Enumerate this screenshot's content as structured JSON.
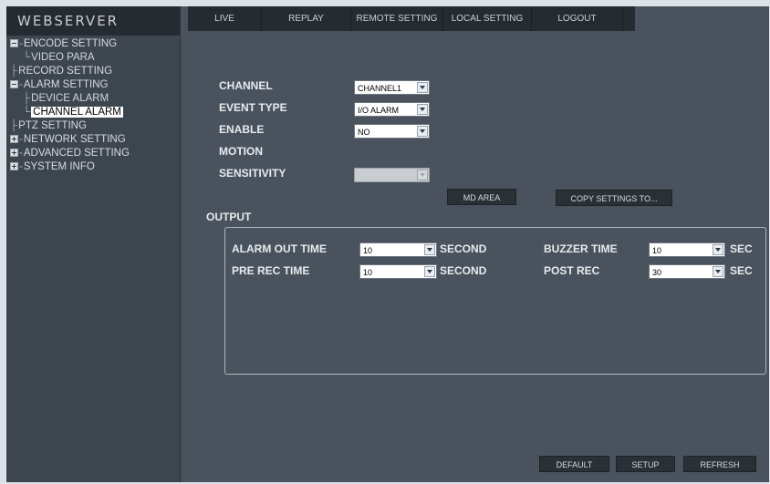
{
  "app": {
    "logo": "WEBSERVER"
  },
  "nav": [
    {
      "label": "LIVE"
    },
    {
      "label": "REPLAY"
    },
    {
      "label": "REMOTE SETTING"
    },
    {
      "label": "LOCAL SETTING"
    },
    {
      "label": "LOGOUT"
    }
  ],
  "tree": {
    "encode": "ENCODE SETTING",
    "video_para": "VIDEO PARA",
    "record": "RECORD SETTING",
    "alarm": "ALARM SETTING",
    "device_alarm": "DEVICE ALARM",
    "channel_alarm": "CHANNEL ALARM",
    "ptz": "PTZ SETTING",
    "network": "NETWORK SETTING",
    "advanced": "ADVANCED SETTING",
    "system_info": "SYSTEM INFO"
  },
  "form": {
    "channel_label": "CHANNEL",
    "channel_value": "CHANNEL1",
    "event_type_label": "EVENT TYPE",
    "event_type_value": "I/O ALARM",
    "enable_label": "ENABLE",
    "enable_value": "NO",
    "motion_label": "MOTION",
    "sensitivity_label": "SENSITIVITY",
    "sensitivity_value": "",
    "md_area_button": "MD AREA",
    "copy_settings_button": "COPY SETTINGS TO...",
    "output_label": "OUTPUT"
  },
  "output": {
    "alarm_out_time_label": "ALARM OUT TIME",
    "alarm_out_time_value": "10",
    "alarm_out_unit": "SECOND",
    "pre_rec_time_label": "PRE REC TIME",
    "pre_rec_time_value": "10",
    "pre_rec_unit": "SECOND",
    "buzzer_time_label": "BUZZER TIME",
    "buzzer_time_value": "10",
    "buzzer_unit": "SEC",
    "post_rec_label": "POST REC",
    "post_rec_value": "30",
    "post_rec_unit": "SEC"
  },
  "footer": {
    "default_button": "DEFAULT",
    "setup_button": "SETUP",
    "refresh_button": "REFRESH"
  },
  "colors": {
    "panel_bg": "#4a535d",
    "sidebar_bg": "#3d454f",
    "bar_bg": "#262b31",
    "selected_bg": "#ffffff"
  }
}
